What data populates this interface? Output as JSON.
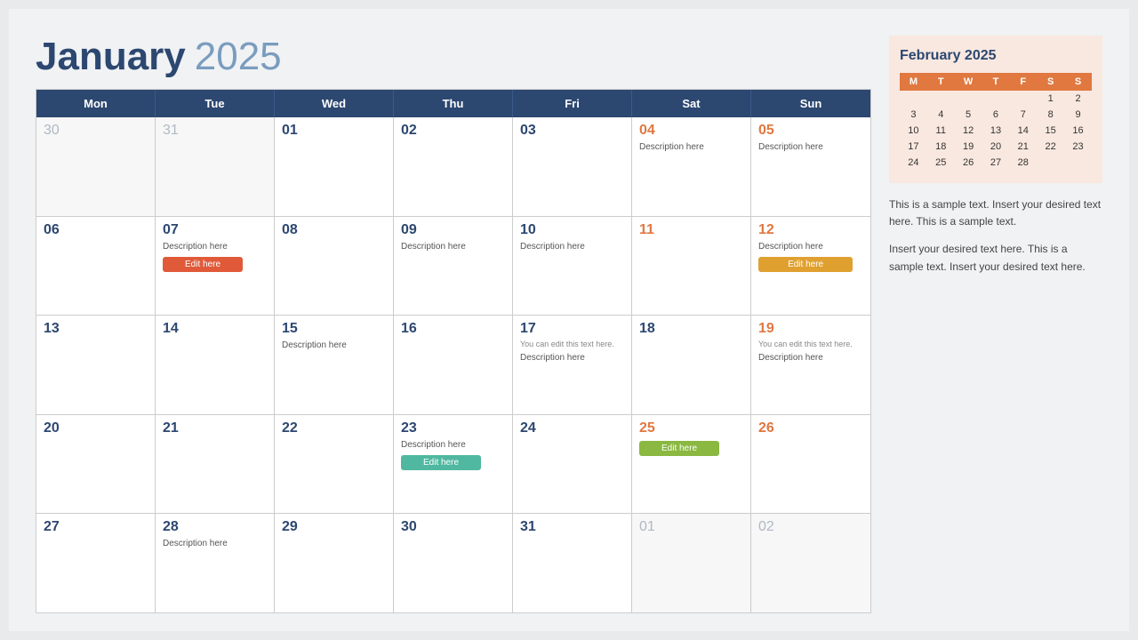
{
  "header": {
    "month": "January",
    "year": "2025"
  },
  "days_header": [
    "Mon",
    "Tue",
    "Wed",
    "Thu",
    "Fri",
    "Sat",
    "Sun"
  ],
  "calendar_rows": [
    [
      {
        "day": "30",
        "muted": true,
        "desc": "",
        "note": "",
        "btn": null
      },
      {
        "day": "31",
        "muted": true,
        "desc": "",
        "note": "",
        "btn": null
      },
      {
        "day": "01",
        "muted": false,
        "desc": "",
        "note": "",
        "btn": null
      },
      {
        "day": "02",
        "muted": false,
        "desc": "",
        "note": "",
        "btn": null
      },
      {
        "day": "03",
        "muted": false,
        "desc": "",
        "note": "",
        "btn": null
      },
      {
        "day": "04",
        "muted": false,
        "orange": true,
        "desc": "Description here",
        "note": "",
        "btn": null
      },
      {
        "day": "05",
        "muted": false,
        "orange": true,
        "desc": "Description here",
        "note": "",
        "btn": null
      }
    ],
    [
      {
        "day": "06",
        "muted": false,
        "desc": "",
        "note": "",
        "btn": null
      },
      {
        "day": "07",
        "muted": false,
        "desc": "Description here",
        "note": "",
        "btn": {
          "label": "Edit here",
          "color": "red"
        }
      },
      {
        "day": "08",
        "muted": false,
        "desc": "",
        "note": "",
        "btn": null
      },
      {
        "day": "09",
        "muted": false,
        "desc": "Description here",
        "note": "",
        "btn": null
      },
      {
        "day": "10",
        "muted": false,
        "desc": "Description here",
        "note": "",
        "btn": null
      },
      {
        "day": "11",
        "muted": false,
        "orange": true,
        "desc": "",
        "note": "",
        "btn": null
      },
      {
        "day": "12",
        "muted": false,
        "orange": true,
        "desc": "Description here",
        "note": "",
        "btn": {
          "label": "Edit here",
          "color": "orange"
        }
      }
    ],
    [
      {
        "day": "13",
        "muted": false,
        "desc": "",
        "note": "",
        "btn": null
      },
      {
        "day": "14",
        "muted": false,
        "desc": "",
        "note": "",
        "btn": null
      },
      {
        "day": "15",
        "muted": false,
        "desc": "Description here",
        "note": "",
        "btn": null
      },
      {
        "day": "16",
        "muted": false,
        "desc": "",
        "note": "",
        "btn": null
      },
      {
        "day": "17",
        "muted": false,
        "desc": "Description here",
        "note": "You can edit this text here.",
        "btn": null
      },
      {
        "day": "18",
        "muted": false,
        "desc": "",
        "note": "",
        "btn": null
      },
      {
        "day": "19",
        "muted": false,
        "orange": true,
        "desc": "Description here",
        "note": "You can edit this text here.",
        "btn": null
      }
    ],
    [
      {
        "day": "20",
        "muted": false,
        "desc": "",
        "note": "",
        "btn": null
      },
      {
        "day": "21",
        "muted": false,
        "desc": "",
        "note": "",
        "btn": null
      },
      {
        "day": "22",
        "muted": false,
        "desc": "",
        "note": "",
        "btn": null
      },
      {
        "day": "23",
        "muted": false,
        "desc": "Description here",
        "note": "",
        "btn": {
          "label": "Edit here",
          "color": "teal"
        }
      },
      {
        "day": "24",
        "muted": false,
        "desc": "",
        "note": "",
        "btn": null
      },
      {
        "day": "25",
        "muted": false,
        "orange": true,
        "desc": "",
        "note": "",
        "btn": {
          "label": "Edit here",
          "color": "green"
        }
      },
      {
        "day": "26",
        "muted": false,
        "orange": true,
        "desc": "",
        "note": "",
        "btn": null
      }
    ],
    [
      {
        "day": "27",
        "muted": false,
        "desc": "",
        "note": "",
        "btn": null
      },
      {
        "day": "28",
        "muted": false,
        "desc": "Description here",
        "note": "",
        "btn": null
      },
      {
        "day": "29",
        "muted": false,
        "desc": "",
        "note": "",
        "btn": null
      },
      {
        "day": "30",
        "muted": false,
        "desc": "",
        "note": "",
        "btn": null
      },
      {
        "day": "31",
        "muted": false,
        "desc": "",
        "note": "",
        "btn": null
      },
      {
        "day": "01",
        "muted": true,
        "desc": "",
        "note": "",
        "btn": null
      },
      {
        "day": "02",
        "muted": true,
        "desc": "",
        "note": "",
        "btn": null
      }
    ]
  ],
  "mini_cal": {
    "title": "February 2025",
    "headers": [
      "M",
      "T",
      "W",
      "T",
      "F",
      "S",
      "S"
    ],
    "rows": [
      [
        "",
        "",
        "",
        "",
        "",
        "1",
        "2"
      ],
      [
        "3",
        "4",
        "5",
        "6",
        "7",
        "8",
        "9"
      ],
      [
        "10",
        "11",
        "12",
        "13",
        "14",
        "15",
        "16"
      ],
      [
        "17",
        "18",
        "19",
        "20",
        "21",
        "22",
        "23"
      ],
      [
        "24",
        "25",
        "26",
        "27",
        "28",
        "",
        ""
      ]
    ]
  },
  "sample_texts": [
    "This is a sample text. Insert your desired text here. This is a sample text.",
    "Insert your desired text here. This is a sample text. Insert your desired text here."
  ],
  "edit_label": "Edit here"
}
